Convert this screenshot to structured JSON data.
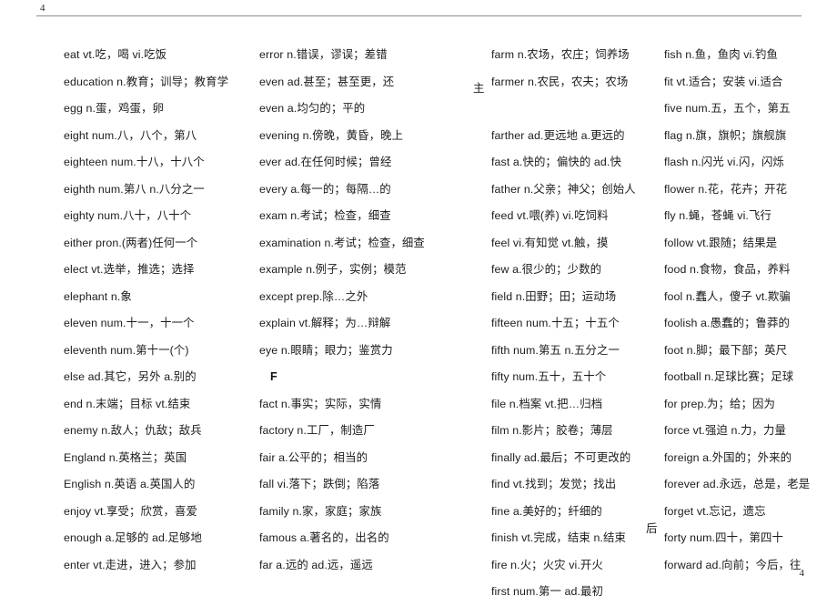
{
  "header": {
    "page_number": "4"
  },
  "footer": {
    "page_number": "4"
  },
  "columns": [
    {
      "id": "column-1",
      "entries": [
        {
          "text": "eat vt.吃，喝 vi.吃饭"
        },
        {
          "text": "education n.教育；训导；教育学"
        },
        {
          "text": "egg n.蛋，鸡蛋，卵"
        },
        {
          "text": "eight num.八，八个，第八"
        },
        {
          "text": "eighteen num.十八，十八个"
        },
        {
          "text": "eighth num.第八 n.八分之一"
        },
        {
          "text": "eighty num.八十，八十个"
        },
        {
          "text": "either pron.(两者)任何一个"
        },
        {
          "text": "elect vt.选举，推选；选择"
        },
        {
          "text": "elephant n.象"
        },
        {
          "text": "eleven num.十一，十一个"
        },
        {
          "text": "eleventh num.第十一(个)"
        },
        {
          "text": "else ad.其它，另外 a.别的"
        },
        {
          "text": "end n.末端；目标 vt.结束"
        },
        {
          "text": "enemy n.敌人；仇敌；敌兵"
        },
        {
          "text": "England n.英格兰；英国"
        },
        {
          "text": "English n.英语 a.英国人的"
        },
        {
          "text": "enjoy vt.享受；欣赏，喜爱"
        },
        {
          "text": "enough a.足够的 ad.足够地"
        },
        {
          "text": "enter vt.走进，进入；参加"
        }
      ]
    },
    {
      "id": "column-2",
      "entries": [
        {
          "text": "error n.错误，谬误；差错"
        },
        {
          "text": "even ad.甚至；甚至更，还"
        },
        {
          "text": "even a.均匀的；平的"
        },
        {
          "text": "evening n.傍晚，黄昏，晚上"
        },
        {
          "text": "ever ad.在任何时候；曾经"
        },
        {
          "text": "every a.每一的；每隔…的"
        },
        {
          "text": "exam n.考试；检查，细查"
        },
        {
          "text": "examination n.考试；检查，细查"
        },
        {
          "text": "example n.例子，实例；模范"
        },
        {
          "text": "except prep.除…之外"
        },
        {
          "text": "explain vt.解释；为…辩解"
        },
        {
          "text": "eye n.眼睛；眼力；鉴赏力"
        },
        {
          "text": "F",
          "type": "section"
        },
        {
          "text": "fact n.事实；实际，实情"
        },
        {
          "text": "factory n.工厂，制造厂"
        },
        {
          "text": "fair a.公平的；相当的"
        },
        {
          "text": "fall vi.落下；跌倒；陷落"
        },
        {
          "text": "family n.家，家庭；家族"
        },
        {
          "text": "famous a.著名的，出名的"
        },
        {
          "text": "far a.远的 ad.远，遥远"
        }
      ]
    },
    {
      "id": "column-3",
      "entries": [
        {
          "text": "farm n.农场，农庄；饲养场"
        },
        {
          "text": "farmer n.农民，农夫；农场"
        },
        {
          "text": "",
          "type": "spacer"
        },
        {
          "text": "farther ad.更远地 a.更远的"
        },
        {
          "text": "fast a.快的；偏快的 ad.快"
        },
        {
          "text": "father n.父亲；神父；创始人"
        },
        {
          "text": "feed vt.喂(养) vi.吃饲料"
        },
        {
          "text": "feel vi.有知觉 vt.触，摸"
        },
        {
          "text": "few a.很少的；少数的"
        },
        {
          "text": "field n.田野；田；运动场"
        },
        {
          "text": "fifteen num.十五；十五个"
        },
        {
          "text": "fifth num.第五 n.五分之一"
        },
        {
          "text": "fifty num.五十，五十个"
        },
        {
          "text": "file n.档案 vt.把…归档"
        },
        {
          "text": "film n.影片；胶卷；薄层"
        },
        {
          "text": "finally ad.最后；不可更改的"
        },
        {
          "text": "find vt.找到；发觉；找出"
        },
        {
          "text": "fine a.美好的；纤细的"
        },
        {
          "text": "finish vt.完成，结束 n.结束"
        },
        {
          "text": "fire n.火；火灾 vi.开火"
        },
        {
          "text": "first num.第一 ad.最初"
        }
      ]
    },
    {
      "id": "column-4",
      "entries": [
        {
          "text": "fish n.鱼，鱼肉 vi.钓鱼"
        },
        {
          "text": "fit vt.适合；安装 vi.适合"
        },
        {
          "text": "five num.五，五个，第五"
        },
        {
          "text": "flag n.旗，旗帜；旗舰旗"
        },
        {
          "text": "flash n.闪光 vi.闪，闪烁"
        },
        {
          "text": "flower n.花，花卉；开花"
        },
        {
          "text": "fly n.蝇，苍蝇 vi.飞行"
        },
        {
          "text": "follow vt.跟随；结果是"
        },
        {
          "text": "food n.食物，食品，养料"
        },
        {
          "text": "fool n.蠢人，傻子 vt.欺骗"
        },
        {
          "text": "foolish a.愚蠢的；鲁莽的"
        },
        {
          "text": "foot n.脚；最下部；英尺"
        },
        {
          "text": "football n.足球比赛；足球"
        },
        {
          "text": "for prep.为；给；因为"
        },
        {
          "text": "force vt.强迫 n.力，力量"
        },
        {
          "text": "foreign a.外国的；外来的"
        },
        {
          "text": "forever ad.永远，总是，老是"
        },
        {
          "text": "forget vt.忘记，遗忘"
        },
        {
          "text": "forty num.四十，第四十"
        },
        {
          "text": "forward ad.向前；今后，往"
        }
      ]
    }
  ],
  "overflow_fragments": [
    {
      "id": "farmer-tail",
      "text": "主"
    },
    {
      "id": "forward-tail",
      "text": "后"
    }
  ]
}
